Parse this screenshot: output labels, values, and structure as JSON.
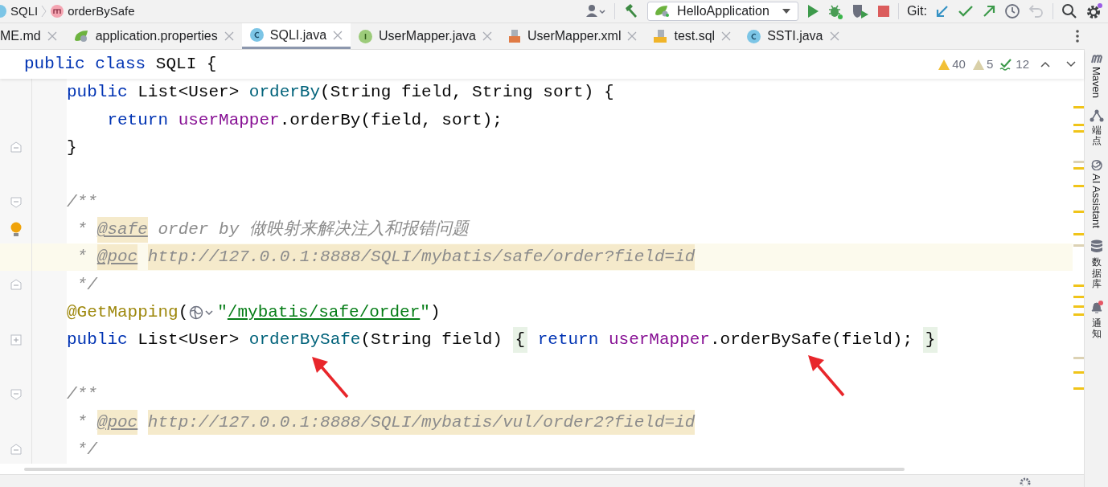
{
  "breadcrumb": [
    {
      "kind": "class",
      "text": "SQLI"
    },
    {
      "kind": "method",
      "text": "orderBySafe"
    }
  ],
  "toolbar": {
    "run_config": "HelloApplication",
    "git_label": "Git:"
  },
  "tabs": [
    {
      "label": "ME.md",
      "kind": "markdown",
      "selected": false
    },
    {
      "label": "application.properties",
      "kind": "spring",
      "selected": false
    },
    {
      "label": "SQLI.java",
      "kind": "class",
      "selected": true
    },
    {
      "label": "UserMapper.java",
      "kind": "interface",
      "selected": false
    },
    {
      "label": "UserMapper.xml",
      "kind": "xml",
      "selected": false
    },
    {
      "label": "test.sql",
      "kind": "sql",
      "selected": false
    },
    {
      "label": "SSTI.java",
      "kind": "class",
      "selected": false
    }
  ],
  "sticky_header": [
    {
      "kind": "keyword",
      "text": "public class "
    },
    {
      "kind": "plain",
      "text": "SQLI {"
    }
  ],
  "inspections": {
    "warnings": "40",
    "weak_warnings": "5",
    "typos": "12"
  },
  "lines": [
    {
      "kind": "plain",
      "current": false,
      "bulb": false,
      "tokens": [
        {
          "kind": "keyword",
          "text": "public "
        },
        {
          "kind": "plain",
          "text": "List<User> "
        },
        {
          "kind": "method",
          "text": "orderBy"
        },
        {
          "kind": "plain",
          "text": "(String field, String sort) {"
        }
      ]
    },
    {
      "kind": "plain",
      "current": false,
      "bulb": false,
      "tokens": [
        {
          "kind": "keyword",
          "text": "    return "
        },
        {
          "kind": "field",
          "text": "userMapper"
        },
        {
          "kind": "plain",
          "text": ".orderBy(field, sort);"
        }
      ]
    },
    {
      "kind": "closer",
      "current": false,
      "bulb": false,
      "tokens": [
        {
          "kind": "plain",
          "text": "}"
        }
      ]
    },
    {
      "kind": "plain",
      "current": false,
      "bulb": false
    },
    {
      "kind": "opener",
      "current": false,
      "bulb": false,
      "tokens": [
        {
          "kind": "comment",
          "text": "/**"
        }
      ]
    },
    {
      "kind": "plain",
      "current": false,
      "bulb": true,
      "tokens": [
        {
          "kind": "comment",
          "text": " * "
        },
        {
          "kind": "doctag",
          "text": "@safe"
        },
        {
          "kind": "comment",
          "text": " order by "
        },
        {
          "kind": "comment",
          "text": "做映射来解决注入和报错问题"
        }
      ]
    },
    {
      "kind": "plain",
      "current": true,
      "bulb": false,
      "tokens": [
        {
          "kind": "comment",
          "text": " * "
        },
        {
          "kind": "doctag",
          "text": "@poc"
        },
        {
          "kind": "url",
          "text": "http://127.0.0.1:8888/SQLI/mybatis/safe/order?field=id"
        }
      ]
    },
    {
      "kind": "closer",
      "current": false,
      "bulb": false,
      "tokens": [
        {
          "kind": "comment",
          "text": " */"
        }
      ]
    },
    {
      "kind": "plain",
      "current": false,
      "bulb": false,
      "tokens": [
        {
          "kind": "annotation",
          "text": "@GetMapping"
        },
        {
          "kind": "plain",
          "text": "("
        },
        {
          "kind": "globe"
        },
        {
          "kind": "string",
          "text": "\""
        },
        {
          "kind": "stringlink",
          "text": "/mybatis/safe/order"
        },
        {
          "kind": "string",
          "text": "\""
        },
        {
          "kind": "plain",
          "text": ")"
        }
      ]
    },
    {
      "kind": "collapsed",
      "current": false,
      "bulb": false,
      "tokens": [
        {
          "kind": "keyword",
          "text": "public "
        },
        {
          "kind": "plain",
          "text": "List<User> "
        },
        {
          "kind": "method",
          "text": "orderBySafe"
        },
        {
          "kind": "plain",
          "text": "(String field) "
        },
        {
          "kind": "brace",
          "text": "{"
        },
        {
          "kind": "keyword",
          "text": " return "
        },
        {
          "kind": "field",
          "text": "userMapper"
        },
        {
          "kind": "plain",
          "text": ".orderBySafe(field); "
        },
        {
          "kind": "brace",
          "text": "}"
        }
      ]
    },
    {
      "kind": "plain",
      "current": false,
      "bulb": false
    },
    {
      "kind": "opener",
      "current": false,
      "bulb": false,
      "tokens": [
        {
          "kind": "comment",
          "text": "/**"
        }
      ]
    },
    {
      "kind": "plain",
      "current": false,
      "bulb": false,
      "tokens": [
        {
          "kind": "comment",
          "text": " * "
        },
        {
          "kind": "doctag",
          "text": "@poc"
        },
        {
          "kind": "url",
          "text": "http://127.0.0.1:8888/SQLI/mybatis/vul/order2?field=id"
        }
      ]
    },
    {
      "kind": "closer",
      "current": false,
      "bulb": false,
      "tokens": [
        {
          "kind": "comment",
          "text": " */"
        }
      ]
    }
  ],
  "tool_windows": [
    {
      "kind": "maven",
      "label": "Maven"
    },
    {
      "kind": "endpoints",
      "label": "端点"
    },
    {
      "kind": "ai",
      "label": "AI Assistant"
    },
    {
      "kind": "database",
      "label": "数据库"
    },
    {
      "kind": "bell",
      "label": "通知"
    }
  ]
}
